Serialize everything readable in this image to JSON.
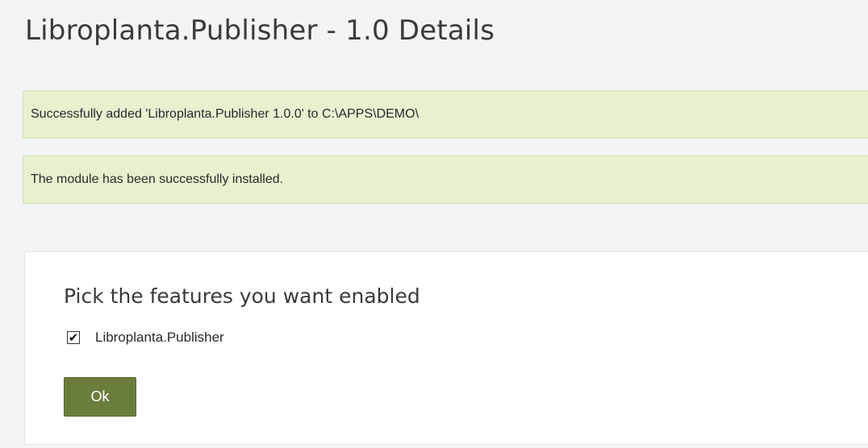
{
  "page": {
    "title": "Libroplanta.Publisher - 1.0 Details"
  },
  "messages": [
    "Successfully added 'Libroplanta.Publisher 1.0.0' to C:\\APPS\\DEMO\\",
    "The module has been successfully installed."
  ],
  "features_panel": {
    "heading": "Pick the features you want enabled",
    "features": [
      {
        "label": "Libroplanta.Publisher",
        "checked": true,
        "check_glyph": "✔"
      }
    ],
    "ok_label": "Ok"
  },
  "colors": {
    "success_bg": "#e6f1d0",
    "success_border": "#d2e3ab",
    "button_bg": "#6b7d3c"
  }
}
